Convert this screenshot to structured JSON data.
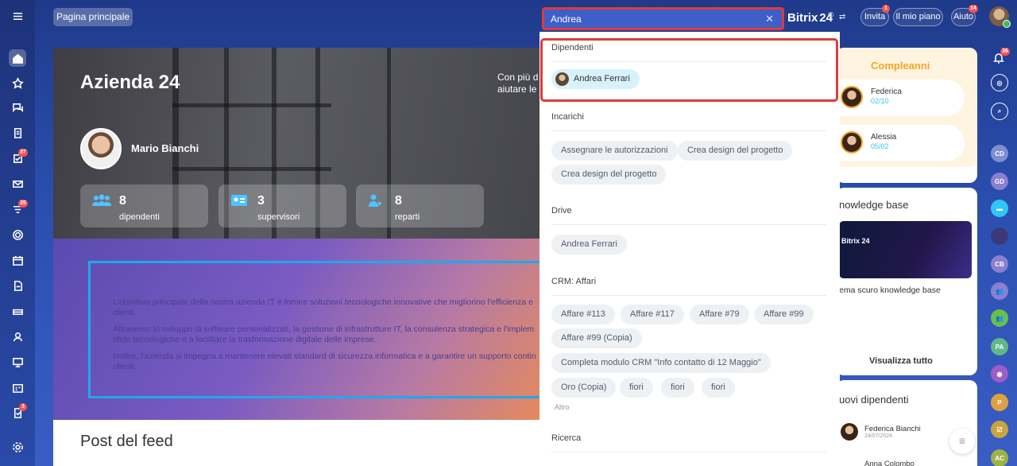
{
  "header": {
    "home_chip": "Pagina principale",
    "search_value": "Andrea",
    "brand": "Bitrix",
    "brand_num": "24",
    "brand_suffix": "©",
    "invite_label": "Invita",
    "invite_badge": "1",
    "plan_label": "Il mio piano",
    "help_label": "Aiuto",
    "help_badge": "14"
  },
  "sidebar_badges": {
    "tasks": "37",
    "feed": "35",
    "approvals": "3"
  },
  "hero": {
    "title": "Azienda 24",
    "description_line1": "Con più d",
    "description_line2": "aiutare le",
    "ceo_name": "Mario Bianchi",
    "stats": [
      {
        "value": "8",
        "label": "dipendenti"
      },
      {
        "value": "3",
        "label": "supervisori"
      },
      {
        "value": "8",
        "label": "reparti"
      }
    ]
  },
  "mission": {
    "p1": "L'obiettivo principale della nostra azienda IT è fornire soluzioni tecnologiche innovative che migliorino l'efficienza e",
    "p1b": "clienti.",
    "p2": "Attraverso lo sviluppo di software personalizzati, la gestione di infrastrutture IT, la consulenza strategica e l'implem",
    "p2b": "sfide tecnologiche e a facilitare la trasformazione digitale delle imprese.",
    "p3": "Inoltre, l'azienda si impegna a mantenere elevati standard di sicurezza informatica e a garantire un supporto contin",
    "p3b": "clienti."
  },
  "feed": {
    "title": "Post del feed"
  },
  "dropdown": {
    "employees_title": "Dipendenti",
    "employee": "Andrea Ferrari",
    "tasks_title": "Incarichi",
    "tasks": [
      "Assegnare le autorizzazioni",
      "Crea design del progetto",
      "Crea design del progetto"
    ],
    "drive_title": "Drive",
    "drive": [
      "Andrea Ferrari"
    ],
    "crm_title": "CRM: Affari",
    "crm": [
      "Affare #113",
      "Affare #117",
      "Affare #79",
      "Affare #99",
      "Affare #99 (Copia)",
      "Completa modulo CRM \"Info contatto di 12 Maggio\"",
      "Oro (Copia)",
      "fiori",
      "fiori",
      "fiori"
    ],
    "more_label": "Altro",
    "search_title": "Ricerca"
  },
  "right": {
    "birthdays_title": "Compleanni",
    "birthdays": [
      {
        "name": "Federica",
        "date": "02/10"
      },
      {
        "name": "Alessia",
        "date": "05/02"
      }
    ],
    "kb_title": "nowledge base",
    "kb_thumb_text": "Bitrix 24",
    "kb_item": "ema scuro knowledge base",
    "kb_view_all": "Visualizza tutto",
    "new_title": "uovi dipendenti",
    "new_employees": [
      {
        "name": "Federica Bianchi",
        "date": "24/07/2024"
      },
      {
        "name": "Anna Colombo"
      }
    ]
  },
  "rightbar": {
    "bell_badge": "36",
    "avatars": [
      "CD",
      "GD",
      "CB",
      "PA",
      "P",
      "AC"
    ]
  },
  "colors": {
    "accent": "#2fc6f6",
    "highlight": "#e03a3a",
    "badge": "#ff4f4f"
  }
}
